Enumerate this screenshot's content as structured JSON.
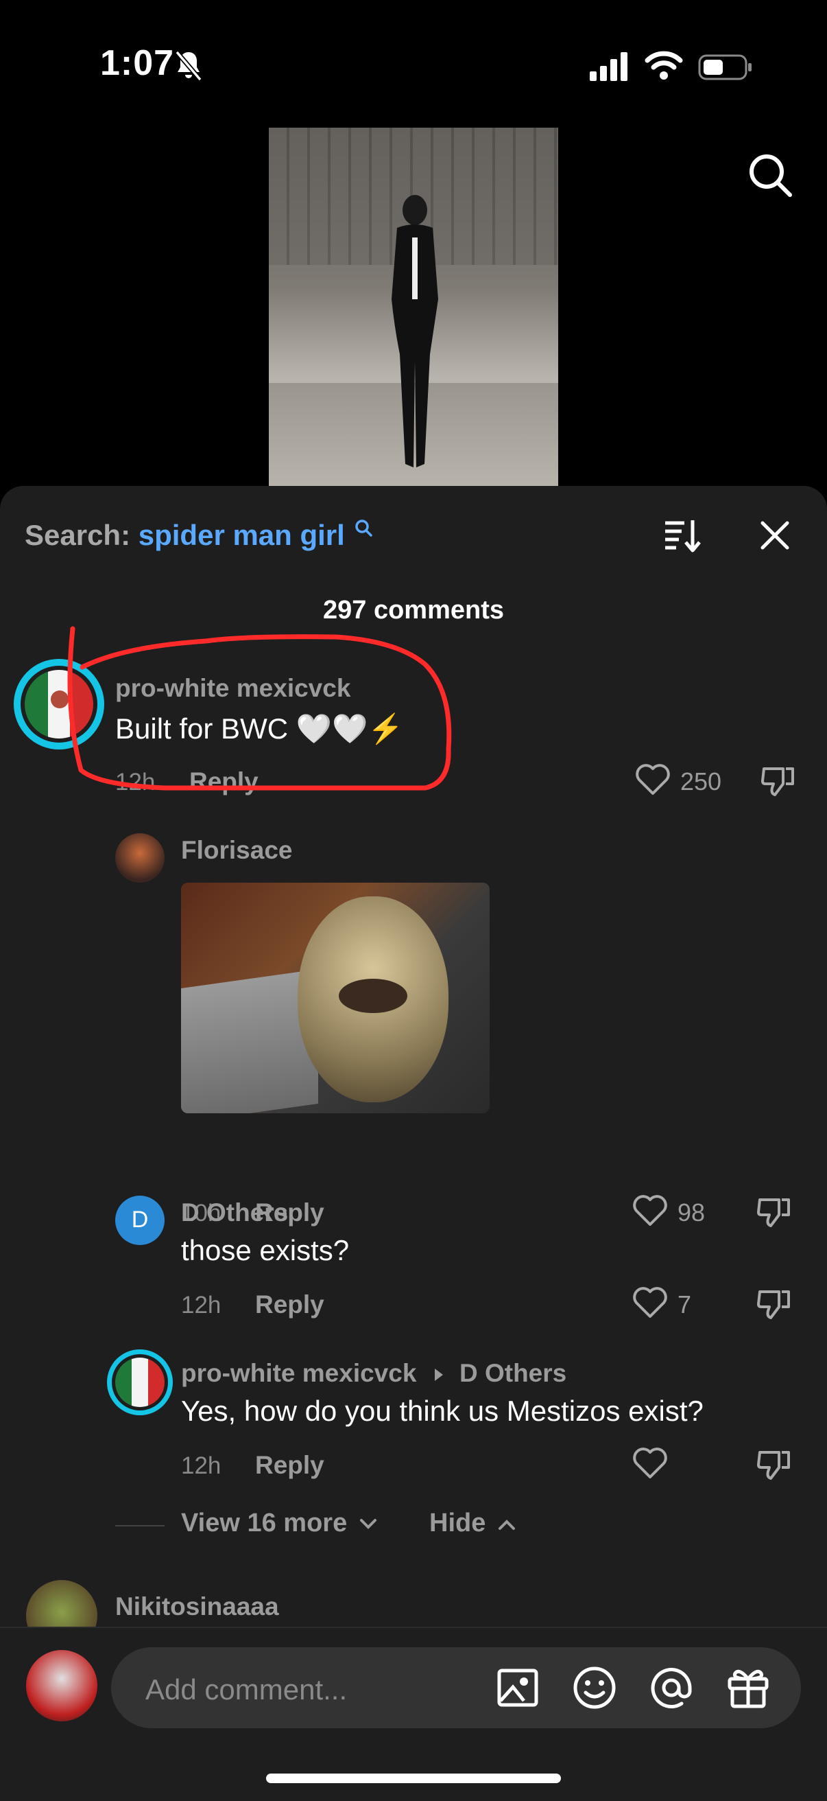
{
  "status": {
    "time": "1:07"
  },
  "sheet": {
    "search_label": "Search:",
    "search_query": "spider man girl",
    "comment_count": "297 comments"
  },
  "comments": [
    {
      "author": "pro-white mexicvck",
      "text": "Built for BWC 🤍🤍⚡",
      "time": "12h",
      "reply": "Reply",
      "likes": "250"
    },
    {
      "author": "Florisace",
      "time": "10h",
      "reply": "Reply",
      "likes": "98"
    },
    {
      "author": "D Others",
      "avatar_letter": "D",
      "text": "those exists?",
      "time": "12h",
      "reply": "Reply",
      "likes": "7"
    },
    {
      "author": "pro-white mexicvck",
      "reply_to": "D Others",
      "text": "Yes, how do you think us Mestizos exist?",
      "time": "12h",
      "reply": "Reply",
      "likes": ""
    },
    {
      "author": "Nikitosinaaaa"
    }
  ],
  "thread": {
    "view_more": "View 16 more",
    "hide": "Hide"
  },
  "composer": {
    "placeholder": "Add comment..."
  },
  "colors": {
    "accent": "#5aa9ff",
    "annotation": "#ff2a2a",
    "sheet_bg": "#1e1e1e"
  },
  "icons": [
    "bell-off-icon",
    "signal-icon",
    "wifi-icon",
    "battery-icon",
    "search-icon",
    "sort-icon",
    "close-icon",
    "heart-icon",
    "dislike-icon",
    "image-icon",
    "emoji-icon",
    "mention-icon",
    "gift-icon",
    "chevron-down-icon",
    "chevron-up-icon",
    "caret-right-icon"
  ]
}
